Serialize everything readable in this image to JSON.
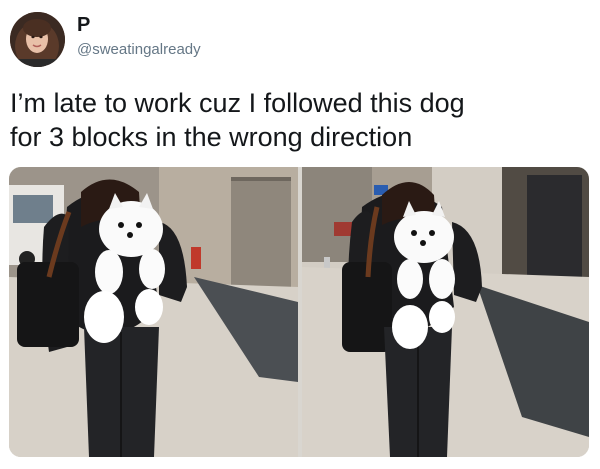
{
  "tweet": {
    "author": {
      "display_name": "P",
      "handle": "@sweatingalready",
      "avatar_icon": "avatar-photo"
    },
    "text_lines": [
      "I’m late to work cuz I followed this dog",
      "for 3 blocks in the wrong direction"
    ],
    "media": [
      {
        "icon": "photo-woman-with-dog-backpack-left"
      },
      {
        "icon": "photo-woman-with-dog-backpack-right"
      }
    ]
  },
  "colors": {
    "text": "#14171a",
    "handle": "#657786"
  }
}
